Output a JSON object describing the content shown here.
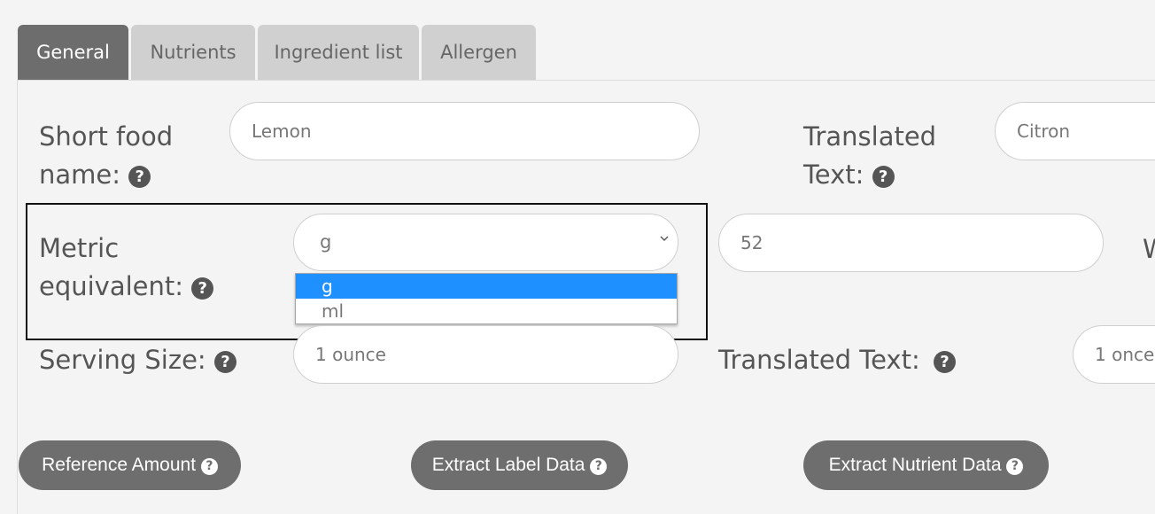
{
  "tabs": [
    {
      "label": "General",
      "active": true
    },
    {
      "label": "Nutrients",
      "active": false
    },
    {
      "label": "Ingredient list",
      "active": false
    },
    {
      "label": "Allergen",
      "active": false
    }
  ],
  "form": {
    "short_food_name": {
      "label_line1": "Short food",
      "label_line2": "name:",
      "value": "Lemon"
    },
    "translated_name": {
      "label_line1": "Translated",
      "label_line2": "Text:",
      "value": "Citron"
    },
    "metric_equivalent": {
      "label_line1": "Metric",
      "label_line2": "equivalent:",
      "unit_selected": "g",
      "unit_options": [
        "g",
        "ml"
      ],
      "amount": "52",
      "clipped_label": "W"
    },
    "serving_size": {
      "label": "Serving Size:",
      "value": "1 ounce"
    },
    "translated_serving": {
      "label": "Translated Text:",
      "value": "1 once"
    }
  },
  "buttons": {
    "reference_amount": "Reference Amount",
    "extract_label_data": "Extract Label Data",
    "extract_nutrient_data": "Extract Nutrient Data"
  },
  "icons": {
    "help": "?",
    "select_chevron": "chevron-down-icon"
  }
}
